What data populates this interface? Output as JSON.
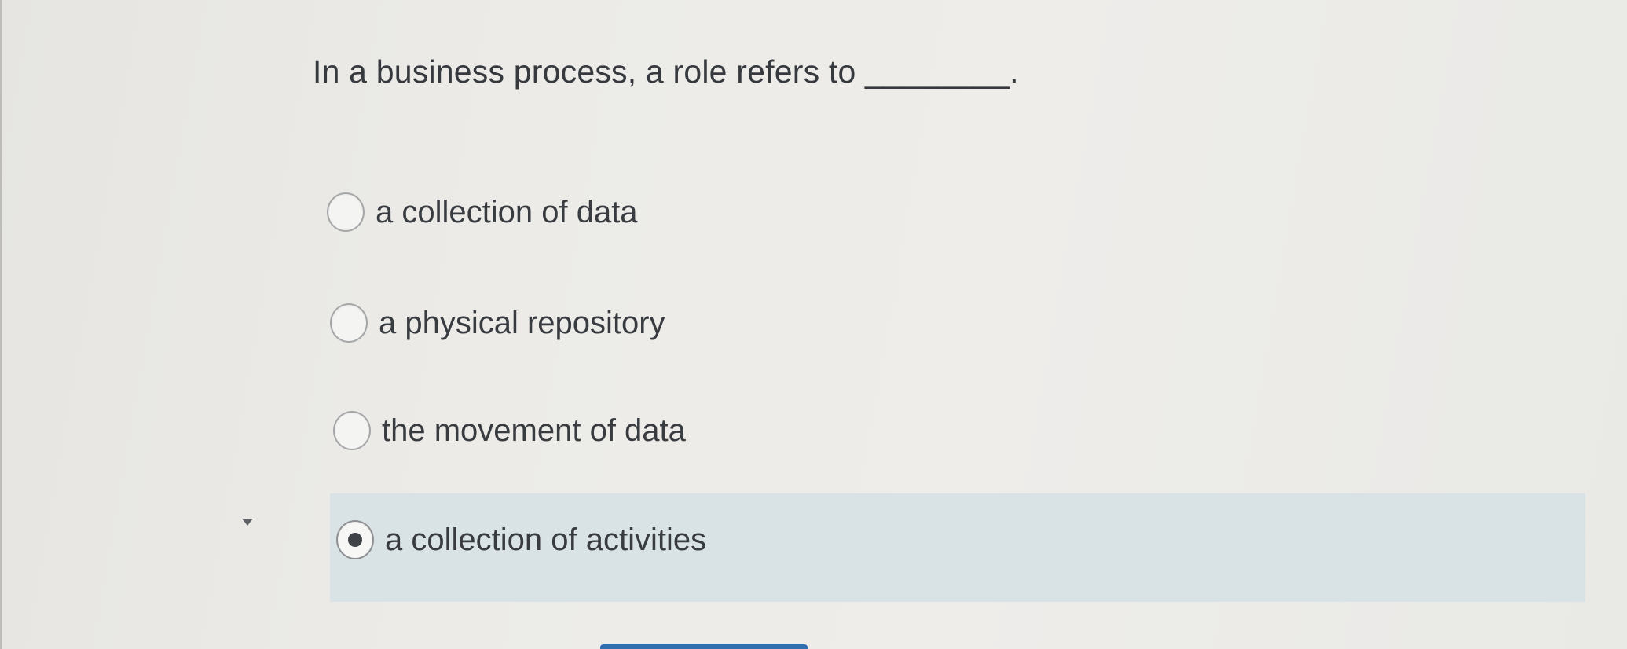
{
  "question": {
    "text": "In a business process, a role refers to ________."
  },
  "options": [
    {
      "label": "a collection of data",
      "selected": false
    },
    {
      "label": "a physical repository",
      "selected": false
    },
    {
      "label": "the movement of data",
      "selected": false
    },
    {
      "label": "a collection of activities",
      "selected": true
    }
  ],
  "colors": {
    "selected_row_background": "#d9e3e6",
    "primary_button": "#2f6fb0"
  }
}
